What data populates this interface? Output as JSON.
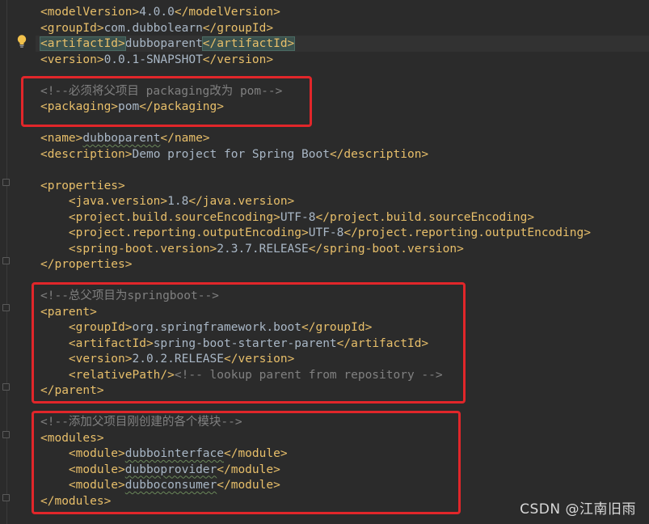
{
  "editor": {
    "lines": [
      {
        "indent": "",
        "parts": [
          [
            "tag",
            "<modelVersion>"
          ],
          [
            "txt",
            "4.0.0"
          ],
          [
            "tag",
            "</modelVersion>"
          ]
        ]
      },
      {
        "indent": "",
        "parts": [
          [
            "tag",
            "<groupId>"
          ],
          [
            "txt",
            "com.dubbolearn"
          ],
          [
            "tag",
            "</groupId>"
          ]
        ]
      },
      {
        "indent": "",
        "parts": [
          [
            "hltag",
            "<artifactId>"
          ],
          [
            "txt",
            "dubboparent"
          ],
          [
            "hltag",
            "</artifactId>"
          ]
        ],
        "highlight": true
      },
      {
        "indent": "",
        "parts": [
          [
            "tag",
            "<version>"
          ],
          [
            "txt",
            "0.0.1-SNAPSHOT"
          ],
          [
            "tag",
            "</version>"
          ]
        ]
      },
      {
        "indent": "",
        "parts": []
      },
      {
        "indent": "",
        "parts": [
          [
            "cmt",
            "<!--必须将父项目 packaging改为 pom-->"
          ]
        ]
      },
      {
        "indent": "",
        "parts": [
          [
            "tag",
            "<packaging>"
          ],
          [
            "txt",
            "pom"
          ],
          [
            "tag",
            "</packaging>"
          ]
        ]
      },
      {
        "indent": "",
        "parts": []
      },
      {
        "indent": "",
        "parts": [
          [
            "tag",
            "<name>"
          ],
          [
            "sq",
            "dubboparent"
          ],
          [
            "tag",
            "</name>"
          ]
        ]
      },
      {
        "indent": "",
        "parts": [
          [
            "tag",
            "<description>"
          ],
          [
            "txt",
            "Demo project for Spring Boot"
          ],
          [
            "tag",
            "</description>"
          ]
        ]
      },
      {
        "indent": "",
        "parts": []
      },
      {
        "indent": "",
        "parts": [
          [
            "tag",
            "<properties>"
          ]
        ]
      },
      {
        "indent": "    ",
        "parts": [
          [
            "tag",
            "<java.version>"
          ],
          [
            "txt",
            "1.8"
          ],
          [
            "tag",
            "</java.version>"
          ]
        ]
      },
      {
        "indent": "    ",
        "parts": [
          [
            "tag",
            "<project.build.sourceEncoding>"
          ],
          [
            "txt",
            "UTF-8"
          ],
          [
            "tag",
            "</project.build.sourceEncoding>"
          ]
        ]
      },
      {
        "indent": "    ",
        "parts": [
          [
            "tag",
            "<project.reporting.outputEncoding>"
          ],
          [
            "txt",
            "UTF-8"
          ],
          [
            "tag",
            "</project.reporting.outputEncoding>"
          ]
        ]
      },
      {
        "indent": "    ",
        "parts": [
          [
            "tag",
            "<spring-boot.version>"
          ],
          [
            "txt",
            "2.3.7.RELEASE"
          ],
          [
            "tag",
            "</spring-boot.version>"
          ]
        ]
      },
      {
        "indent": "",
        "parts": [
          [
            "tag",
            "</properties>"
          ]
        ]
      },
      {
        "indent": "",
        "parts": []
      },
      {
        "indent": "",
        "parts": [
          [
            "cmt",
            "<!--总父项目为springboot-->"
          ]
        ]
      },
      {
        "indent": "",
        "parts": [
          [
            "tag",
            "<parent>"
          ]
        ]
      },
      {
        "indent": "    ",
        "parts": [
          [
            "tag",
            "<groupId>"
          ],
          [
            "txt",
            "org.springframework.boot"
          ],
          [
            "tag",
            "</groupId>"
          ]
        ]
      },
      {
        "indent": "    ",
        "parts": [
          [
            "tag",
            "<artifactId>"
          ],
          [
            "txt",
            "spring-boot-starter-parent"
          ],
          [
            "tag",
            "</artifactId>"
          ]
        ]
      },
      {
        "indent": "    ",
        "parts": [
          [
            "tag",
            "<version>"
          ],
          [
            "txt",
            "2.0.2.RELEASE"
          ],
          [
            "tag",
            "</version>"
          ]
        ]
      },
      {
        "indent": "    ",
        "parts": [
          [
            "tag",
            "<relativePath/>"
          ],
          [
            "cmt",
            "<!-- lookup parent from repository -->"
          ]
        ]
      },
      {
        "indent": "",
        "parts": [
          [
            "tag",
            "</parent>"
          ]
        ]
      },
      {
        "indent": "",
        "parts": []
      },
      {
        "indent": "",
        "parts": [
          [
            "cmt",
            "<!--添加父项目刚创建的各个模块-->"
          ]
        ]
      },
      {
        "indent": "",
        "parts": [
          [
            "tag",
            "<modules>"
          ]
        ]
      },
      {
        "indent": "    ",
        "parts": [
          [
            "tag",
            "<module>"
          ],
          [
            "sq",
            "dubbointerface"
          ],
          [
            "tag",
            "</module>"
          ]
        ]
      },
      {
        "indent": "    ",
        "parts": [
          [
            "tag",
            "<module>"
          ],
          [
            "sq",
            "dubboprovider"
          ],
          [
            "tag",
            "</module>"
          ]
        ]
      },
      {
        "indent": "    ",
        "parts": [
          [
            "tag",
            "<module>"
          ],
          [
            "sq",
            "dubboconsumer"
          ],
          [
            "tag",
            "</module>"
          ]
        ]
      },
      {
        "indent": "",
        "parts": [
          [
            "tag",
            "</modules>"
          ]
        ]
      }
    ]
  },
  "colors": {
    "background": "#2b2b2b",
    "tag": "#e8bf6a",
    "text": "#a9b7c6",
    "comment": "#808080",
    "annotation_box": "#e1262a"
  },
  "icons": {
    "gutter": "intention-bulb-icon"
  },
  "watermark": {
    "text": "CSDN @江南旧雨"
  }
}
